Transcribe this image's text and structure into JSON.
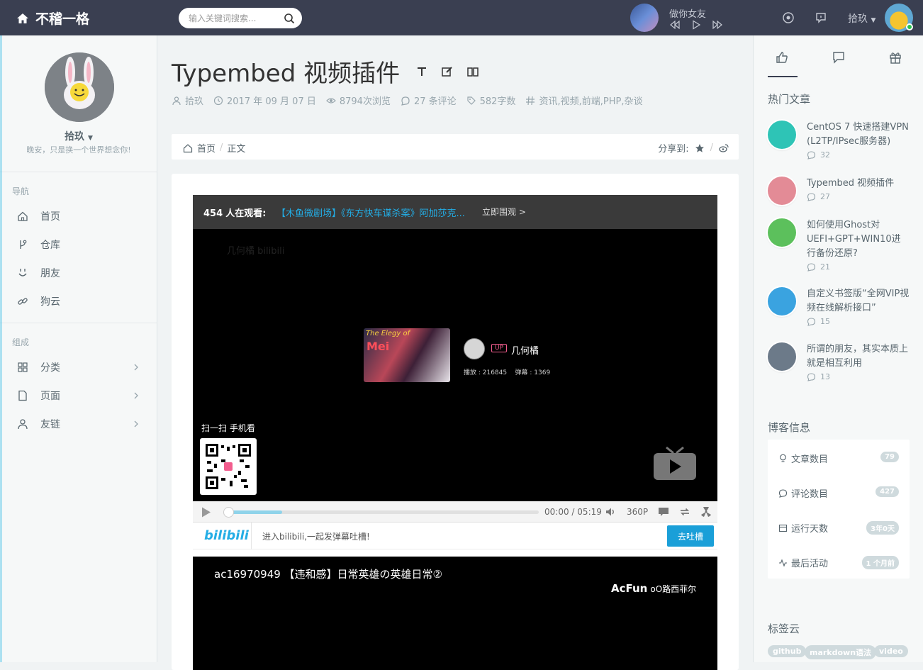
{
  "topbar": {
    "brand": "不稽一格",
    "search_placeholder": "输入关键词搜索...",
    "music_title": "做你女友",
    "user": "拾玖"
  },
  "profile": {
    "name": "拾玖",
    "motto": "晚安，只是换一个世界想念你!"
  },
  "nav": {
    "head1": "导航",
    "items1": [
      "首页",
      "仓库",
      "朋友",
      "狗云"
    ],
    "head2": "组成",
    "items2": [
      "分类",
      "页面",
      "友链"
    ]
  },
  "post": {
    "title": "Typembed 视频插件",
    "meta": {
      "author": "拾玖",
      "date": "2017 年 09 月 07 日",
      "views": "8794次浏览",
      "comments": "27 条评论",
      "words": "582字数",
      "tags": "资讯,视频,前端,PHP,杂谈"
    },
    "breadcrumb": {
      "home": "首页",
      "current": "正文",
      "share": "分享到:"
    }
  },
  "player": {
    "watching_count": "454",
    "watching_label": "人在观看:",
    "link": "【木鱼微剧场】《东方快车谋杀案》阿加莎克...",
    "go": "立即围观",
    "faint_logo": "几何橘 bilibili",
    "thumb_title": "The Elegy of",
    "thumb_main": "Mei",
    "up_tag": "UP",
    "up_name": "几何橘",
    "stats": "播放 : 216845    弹幕 : 1369",
    "scan": "扫一扫 手机看",
    "time_current": "00:00",
    "time_sep": "/",
    "time_total": "05:19",
    "quality": "360P",
    "bili_logo": "bilibili",
    "bili_text": "进入bilibili,一起发弹幕吐槽!",
    "bili_btn": "去吐槽",
    "progress_fraction": 0.0
  },
  "acfun": {
    "title": "ac16970949 【违和感】日常英雄の英雄日常②",
    "logo": "AcFun",
    "uploader": "oO路西菲尔"
  },
  "right": {
    "hot_head": "热门文章",
    "hot": [
      {
        "title": "CentOS 7 快速搭建VPN (L2TP/IPsec服务器)",
        "count": "32",
        "color": "#2ec4b6"
      },
      {
        "title": "Typembed 视频插件",
        "count": "27",
        "color": "#e38b96"
      },
      {
        "title": "如何使用Ghost对UEFI+GPT+WIN10进行备份还原?",
        "count": "21",
        "color": "#5cc05c"
      },
      {
        "title": "自定义书签版“全网VIP视频在线解析接口”",
        "count": "15",
        "color": "#3aa3e0"
      },
      {
        "title": "所谓的朋友，其实本质上就是相互利用",
        "count": "13",
        "color": "#6c7a89"
      }
    ],
    "info_head": "博客信息",
    "info": [
      {
        "label": "文章数目",
        "value": "79"
      },
      {
        "label": "评论数目",
        "value": "427"
      },
      {
        "label": "运行天数",
        "value": "3年0天"
      },
      {
        "label": "最后活动",
        "value": "1 个月前"
      }
    ],
    "tags_head": "标签云",
    "tags": [
      "github",
      "markdown语法",
      "video"
    ]
  }
}
